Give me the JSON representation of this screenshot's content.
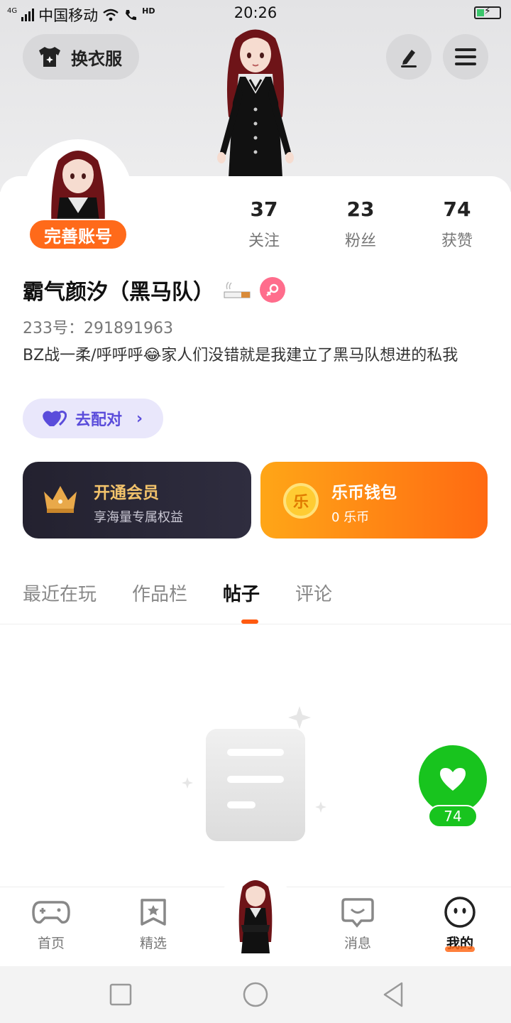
{
  "status_bar": {
    "network": "4G",
    "carrier": "中国移动",
    "call_badge": "HD",
    "time": "20:26"
  },
  "header": {
    "outfit_label": "换衣服",
    "edit_icon": "pencil-icon",
    "menu_icon": "hamburger-icon"
  },
  "profile": {
    "complete_account_label": "完善账号",
    "username": "霸气颜汐（黑马队）",
    "uid": "233号：291891963",
    "bio": "BZ战一柔/呼呼呼😂家人们没错就是我建立了黑马队想进的私我",
    "match_label": "去配对",
    "stats": [
      {
        "value": "37",
        "label": "关注"
      },
      {
        "value": "23",
        "label": "粉丝"
      },
      {
        "value": "74",
        "label": "获赞"
      }
    ]
  },
  "cards": {
    "vip": {
      "title": "开通会员",
      "subtitle": "享海量专属权益"
    },
    "wallet": {
      "title": "乐币钱包",
      "subtitle": "0 乐币",
      "coin_char": "乐"
    }
  },
  "tabs": [
    "最近在玩",
    "作品栏",
    "帖子",
    "评论"
  ],
  "active_tab": "帖子",
  "like": {
    "count": "74"
  },
  "bottom_nav": {
    "items": [
      {
        "label": "首页",
        "icon": "gamepad-icon"
      },
      {
        "label": "精选",
        "icon": "star-bookmark-icon"
      },
      {
        "label": "消息",
        "icon": "chat-bubble-icon"
      },
      {
        "label": "我的",
        "icon": "smiley-face-icon"
      }
    ]
  },
  "colors": {
    "accent": "#ff6a1a",
    "like_green": "#18c41e",
    "match_purple": "#5a4cdb",
    "gender_pink": "#ff6d8c"
  }
}
